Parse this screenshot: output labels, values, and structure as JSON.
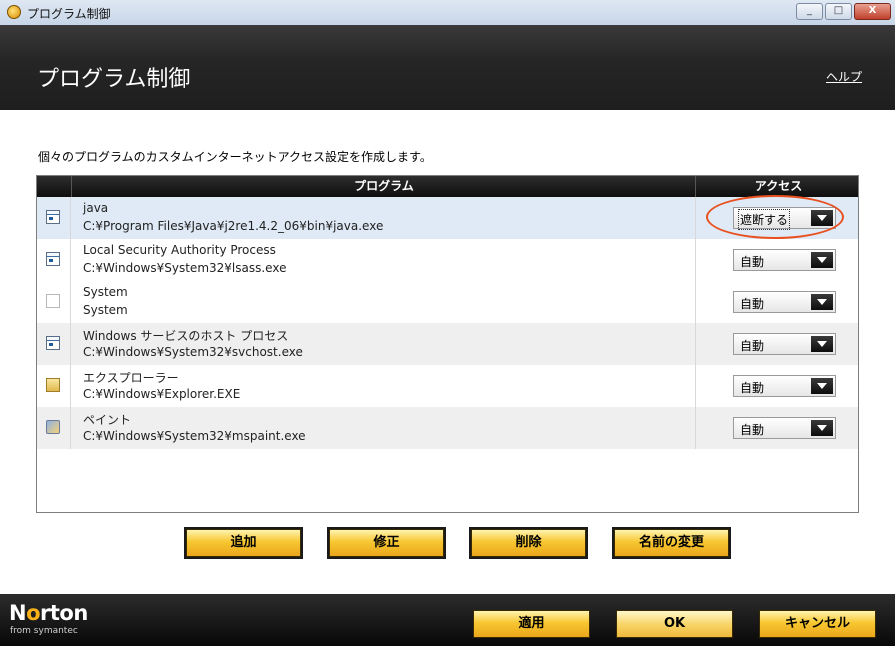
{
  "window": {
    "title": "プログラム制御",
    "min": "_",
    "max": "□",
    "close": "X"
  },
  "header": {
    "title": "プログラム制御",
    "help": "ヘルプ"
  },
  "description": "個々のプログラムのカスタムインターネットアクセス設定を作成します。",
  "table": {
    "columns": [
      "プログラム",
      "アクセス"
    ],
    "rows": [
      {
        "name": "java",
        "path": "C:¥Program Files¥Java¥j2re1.4.2_06¥bin¥java.exe",
        "access": "遮断する",
        "icon": "java-exe-icon"
      },
      {
        "name": "Local Security Authority Process",
        "path": "C:¥Windows¥System32¥lsass.exe",
        "access": "自動",
        "icon": "lsass-exe-icon"
      },
      {
        "name": "System",
        "path": "System",
        "access": "自動",
        "icon": "system-file-icon"
      },
      {
        "name": "Windows サービスのホスト プロセス",
        "path": "C:¥Windows¥System32¥svchost.exe",
        "access": "自動",
        "icon": "svchost-exe-icon"
      },
      {
        "name": "エクスプローラー",
        "path": "C:¥Windows¥Explorer.EXE",
        "access": "自動",
        "icon": "explorer-icon"
      },
      {
        "name": "ペイント",
        "path": "C:¥Windows¥System32¥mspaint.exe",
        "access": "自動",
        "icon": "paint-icon"
      }
    ]
  },
  "actions": {
    "add": "追加",
    "edit": "修正",
    "delete": "削除",
    "rename": "名前の変更"
  },
  "footer": {
    "logo_n": "N",
    "logo_o": "o",
    "logo_rest": "rton",
    "logo_sub": "from symantec",
    "apply": "適用",
    "ok": "OK",
    "cancel": "キャンセル"
  },
  "colors": {
    "accent_button": "#f7c731",
    "highlight_ring": "#e8501f",
    "header_bg": "#262626"
  }
}
